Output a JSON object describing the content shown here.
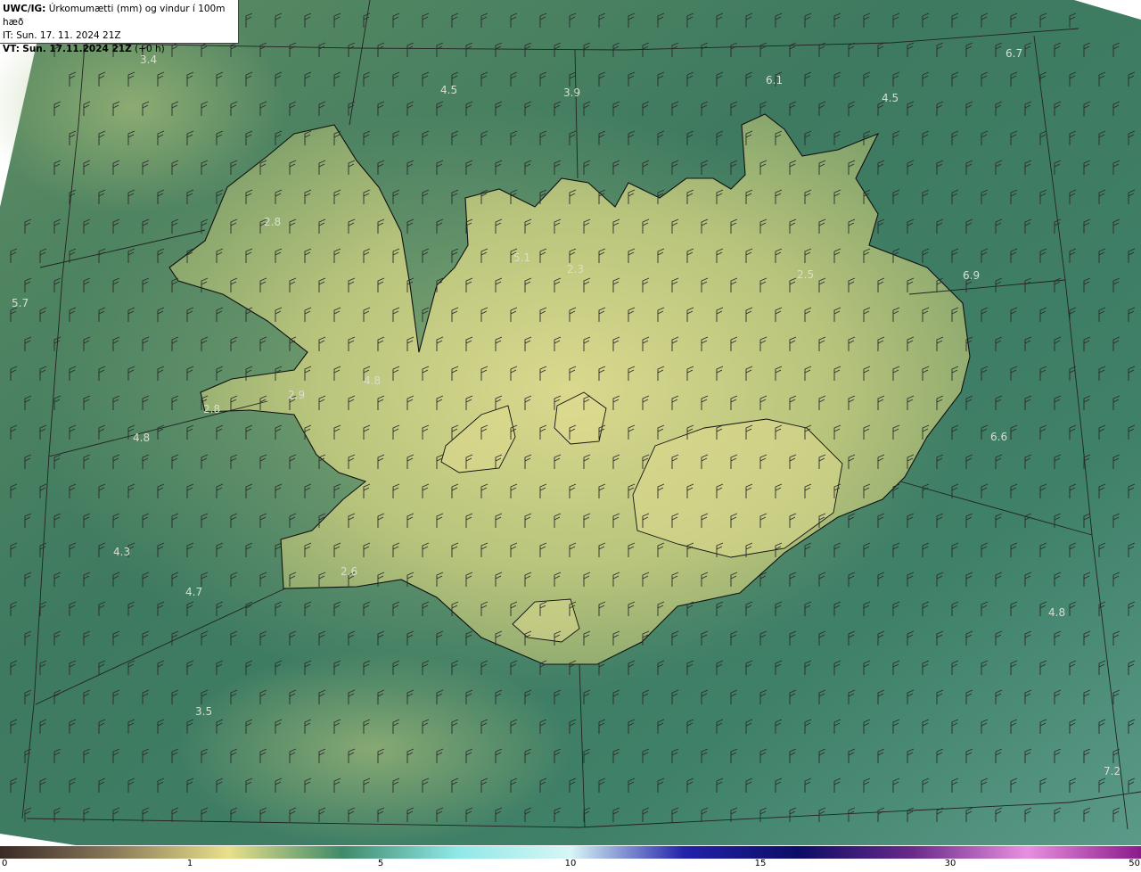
{
  "header": {
    "product": "UWC/IG:",
    "description": "Úrkomumætti (mm) og vindur í 100m hæð",
    "it_line": "IT: Sun. 17. 11. 2024 21Z",
    "vt_prefix": "VT:",
    "vt_bold": "Sun. 17.11.2024 21Z",
    "vt_suffix": "(+0 h)"
  },
  "colors": {
    "sea_dark": "#2f6b58",
    "sea_mid": "#3f7e63",
    "land_light": "#c9d38a",
    "coast_line": "#111111",
    "grid_line": "#222222"
  },
  "map_labels": [
    "3.4",
    "4.5",
    "3.9",
    "6.1",
    "4.5",
    "6.7",
    "2.8",
    "5.1",
    "2.3",
    "2.5",
    "6.9",
    "5.7",
    "4.8",
    "2.9",
    "2.8",
    "4.8",
    "6.6",
    "4.3",
    "2.6",
    "4.7",
    "4.8",
    "3.5",
    "7.2"
  ],
  "colorbar": {
    "ticks": [
      "0",
      "1",
      "5",
      "10",
      "15",
      "30",
      "50"
    ],
    "tick_values": [
      0,
      1,
      5,
      10,
      15,
      30,
      50
    ],
    "stops": [
      "#3a2a25",
      "#8a7a5a",
      "#e9e08a",
      "#3f8a6a",
      "#8fe8e8",
      "#d8f6f6",
      "#2222aa",
      "#0c0c66",
      "#6a2a8a",
      "#e890e0",
      "#8a1a8a"
    ]
  }
}
